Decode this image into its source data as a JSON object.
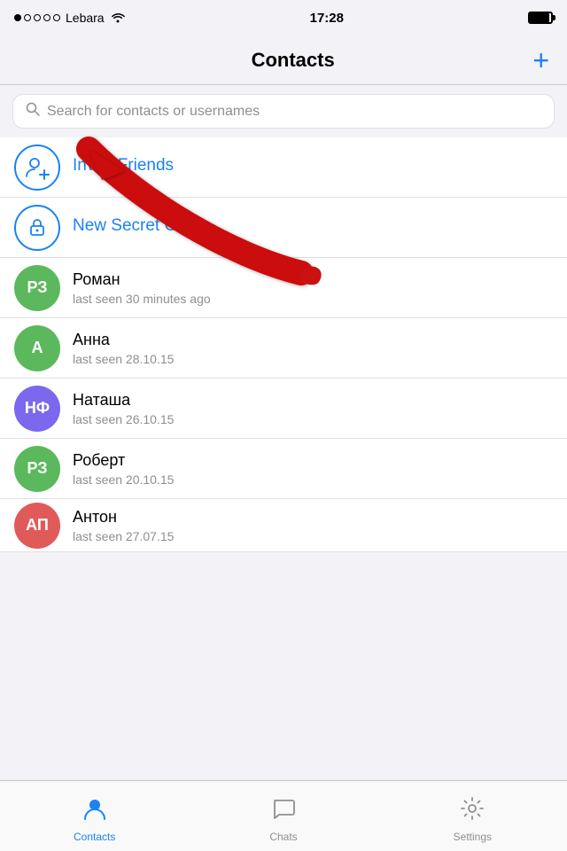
{
  "statusBar": {
    "carrier": "Lebara",
    "time": "17:28"
  },
  "header": {
    "title": "Contacts",
    "addButton": "+"
  },
  "search": {
    "placeholder": "Search for contacts or usernames"
  },
  "quickActions": [
    {
      "id": "invite-friends",
      "label": "Invite Friends",
      "type": "invite"
    },
    {
      "id": "new-secret-chat",
      "label": "New Secret Chat",
      "type": "secret"
    }
  ],
  "contacts": [
    {
      "id": "roman",
      "initials": "РЗ",
      "name": "Роман",
      "subtitle": "last seen 30 minutes ago",
      "avatarColor": "green"
    },
    {
      "id": "anna",
      "initials": "А",
      "name": "Анна",
      "subtitle": "last seen 28.10.15",
      "avatarColor": "green"
    },
    {
      "id": "natasha",
      "initials": "НФ",
      "name": "Наташа",
      "subtitle": "last seen 26.10.15",
      "avatarColor": "purple"
    },
    {
      "id": "robert",
      "initials": "РЗ",
      "name": "Роберт",
      "subtitle": "last seen 20.10.15",
      "avatarColor": "green"
    },
    {
      "id": "anton",
      "initials": "АП",
      "name": "Антон",
      "subtitle": "last seen 27.07.15",
      "avatarColor": "red"
    }
  ],
  "tabBar": {
    "tabs": [
      {
        "id": "contacts",
        "label": "Contacts",
        "active": true
      },
      {
        "id": "chats",
        "label": "Chats",
        "active": false
      },
      {
        "id": "settings",
        "label": "Settings",
        "active": false
      }
    ]
  }
}
